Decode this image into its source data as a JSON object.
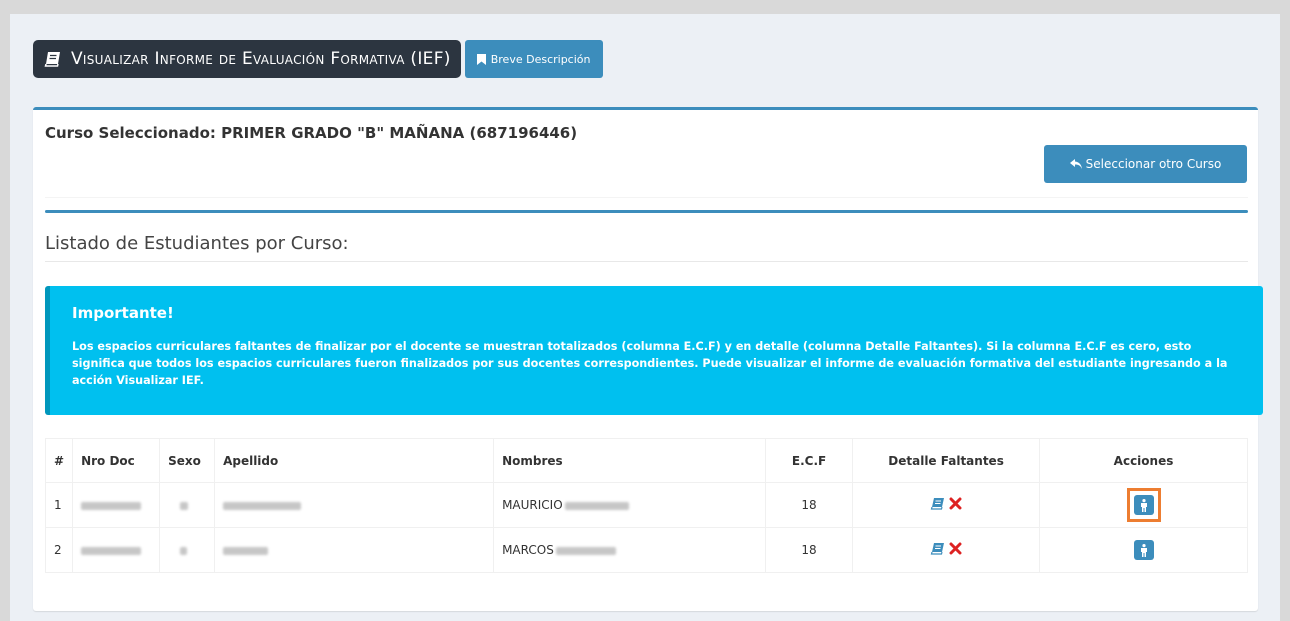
{
  "header": {
    "title": "Visualizar Informe de Evaluación Formativa (IEF)",
    "description_button": "Breve Descripción"
  },
  "course": {
    "label": "Curso Seleccionado: PRIMER GRADO \"B\" MAÑANA (687196446)",
    "change_button": "Seleccionar otro Curso"
  },
  "list": {
    "heading": "Listado de Estudiantes por Curso:"
  },
  "callout": {
    "title": "Importante!",
    "text": "Los espacios curriculares faltantes de finalizar por el docente se muestran totalizados (columna E.C.F) y en detalle (columna Detalle Faltantes). Si la columna E.C.F es cero, esto significa que todos los espacios curriculares fueron finalizados por sus docentes correspondientes. Puede visualizar el informe de evaluación formativa del estudiante ingresando a la acción Visualizar IEF."
  },
  "table": {
    "headers": [
      "#",
      "Nro Doc",
      "Sexo",
      "Apellido",
      "Nombres",
      "E.C.F",
      "Detalle Faltantes",
      "Acciones"
    ],
    "rows": [
      {
        "num": "1",
        "nombres": "MAURICIO",
        "ecf": "18"
      },
      {
        "num": "2",
        "nombres": "MARCOS",
        "ecf": "18"
      }
    ]
  },
  "icons": {
    "title": "book-icon",
    "description": "bookmark-icon",
    "change": "reply-arrow-icon",
    "detail_view": "book-icon",
    "detail_remove": "close-icon",
    "action": "person-icon"
  },
  "colors": {
    "primary": "#3c8dbc",
    "title_bg": "#2c3540",
    "callout_bg": "#00c0ef",
    "remove": "#dd2222",
    "highlight": "#ed7d31"
  }
}
